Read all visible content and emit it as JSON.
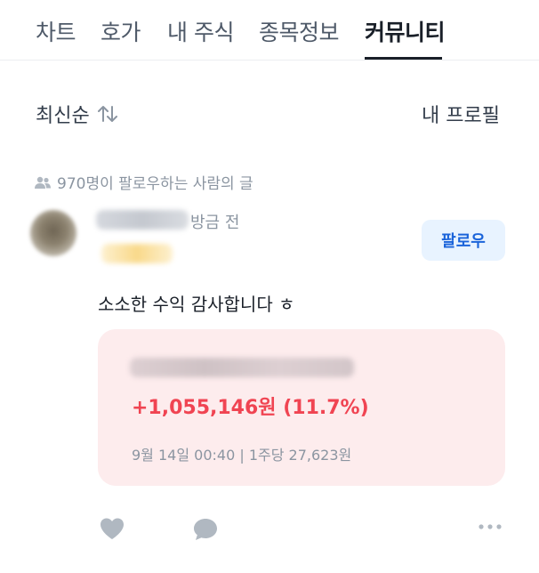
{
  "tabs": [
    {
      "label": "차트"
    },
    {
      "label": "호가"
    },
    {
      "label": "내 주식"
    },
    {
      "label": "종목정보"
    },
    {
      "label": "커뮤니티",
      "active": true
    }
  ],
  "sort": {
    "label": "최신순",
    "icon": "sort-arrows-icon"
  },
  "profile_link": {
    "label": "내 프로필"
  },
  "feed": {
    "followers_text": "970명이 팔로우하는 사람의 글",
    "icon": "people-icon"
  },
  "post": {
    "time": "방금 전",
    "follow_label": "팔로우",
    "text": "소소한 수익 감사합니다 ㅎ",
    "trade": {
      "profit": "+1,055,146원 (11.7%)",
      "info": "9월 14일 00:40 | 1주당 27,623원"
    },
    "actions": [
      "heart-icon",
      "comment-icon",
      "more-icon"
    ]
  },
  "colors": {
    "accent_blue": "#1b64da",
    "follow_bg": "#e8f3ff",
    "profit_red": "#f04452",
    "card_bg": "#fdeced",
    "muted_text": "#8b95a1"
  }
}
